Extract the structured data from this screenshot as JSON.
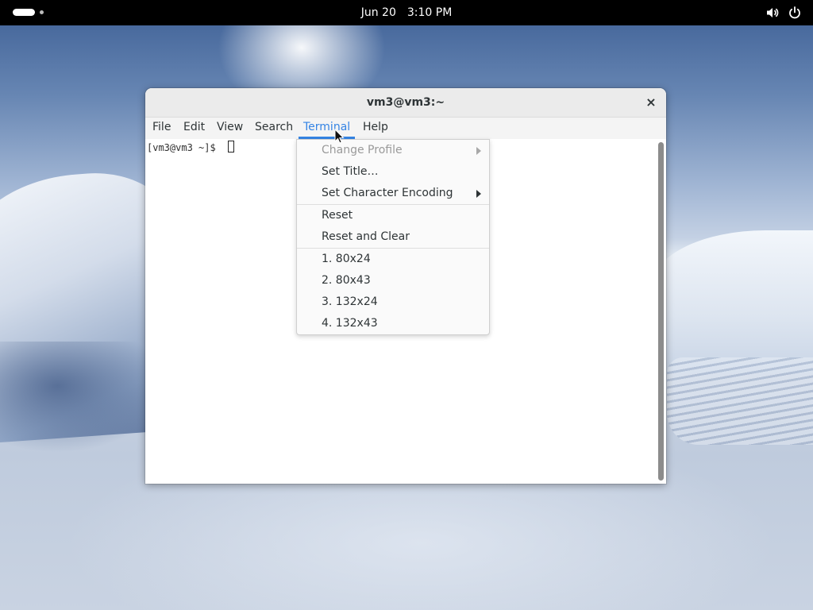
{
  "topbar": {
    "date": "Jun 20",
    "time": "3:10 PM",
    "icons": [
      "activities-indicator",
      "volume-icon",
      "power-icon"
    ]
  },
  "window": {
    "title": "vm3@vm3:~",
    "close_label": "×",
    "menubar": [
      {
        "label": "File"
      },
      {
        "label": "Edit"
      },
      {
        "label": "View"
      },
      {
        "label": "Search"
      },
      {
        "label": "Terminal",
        "active": true
      },
      {
        "label": "Help"
      }
    ],
    "prompt": "[vm3@vm3 ~]$"
  },
  "terminal_menu": {
    "items": [
      {
        "label": "Change Profile",
        "disabled": true,
        "submenu": true
      },
      {
        "label": "Set Title…"
      },
      {
        "label": "Set Character Encoding",
        "submenu": true
      },
      {
        "label": "Reset"
      },
      {
        "label": "Reset and Clear"
      },
      {
        "label": "1. 80x24"
      },
      {
        "label": "2. 80x43"
      },
      {
        "label": "3. 132x24"
      },
      {
        "label": "4. 132x43"
      }
    ]
  },
  "colors": {
    "accent": "#3584e4",
    "topbar": "#000000"
  }
}
